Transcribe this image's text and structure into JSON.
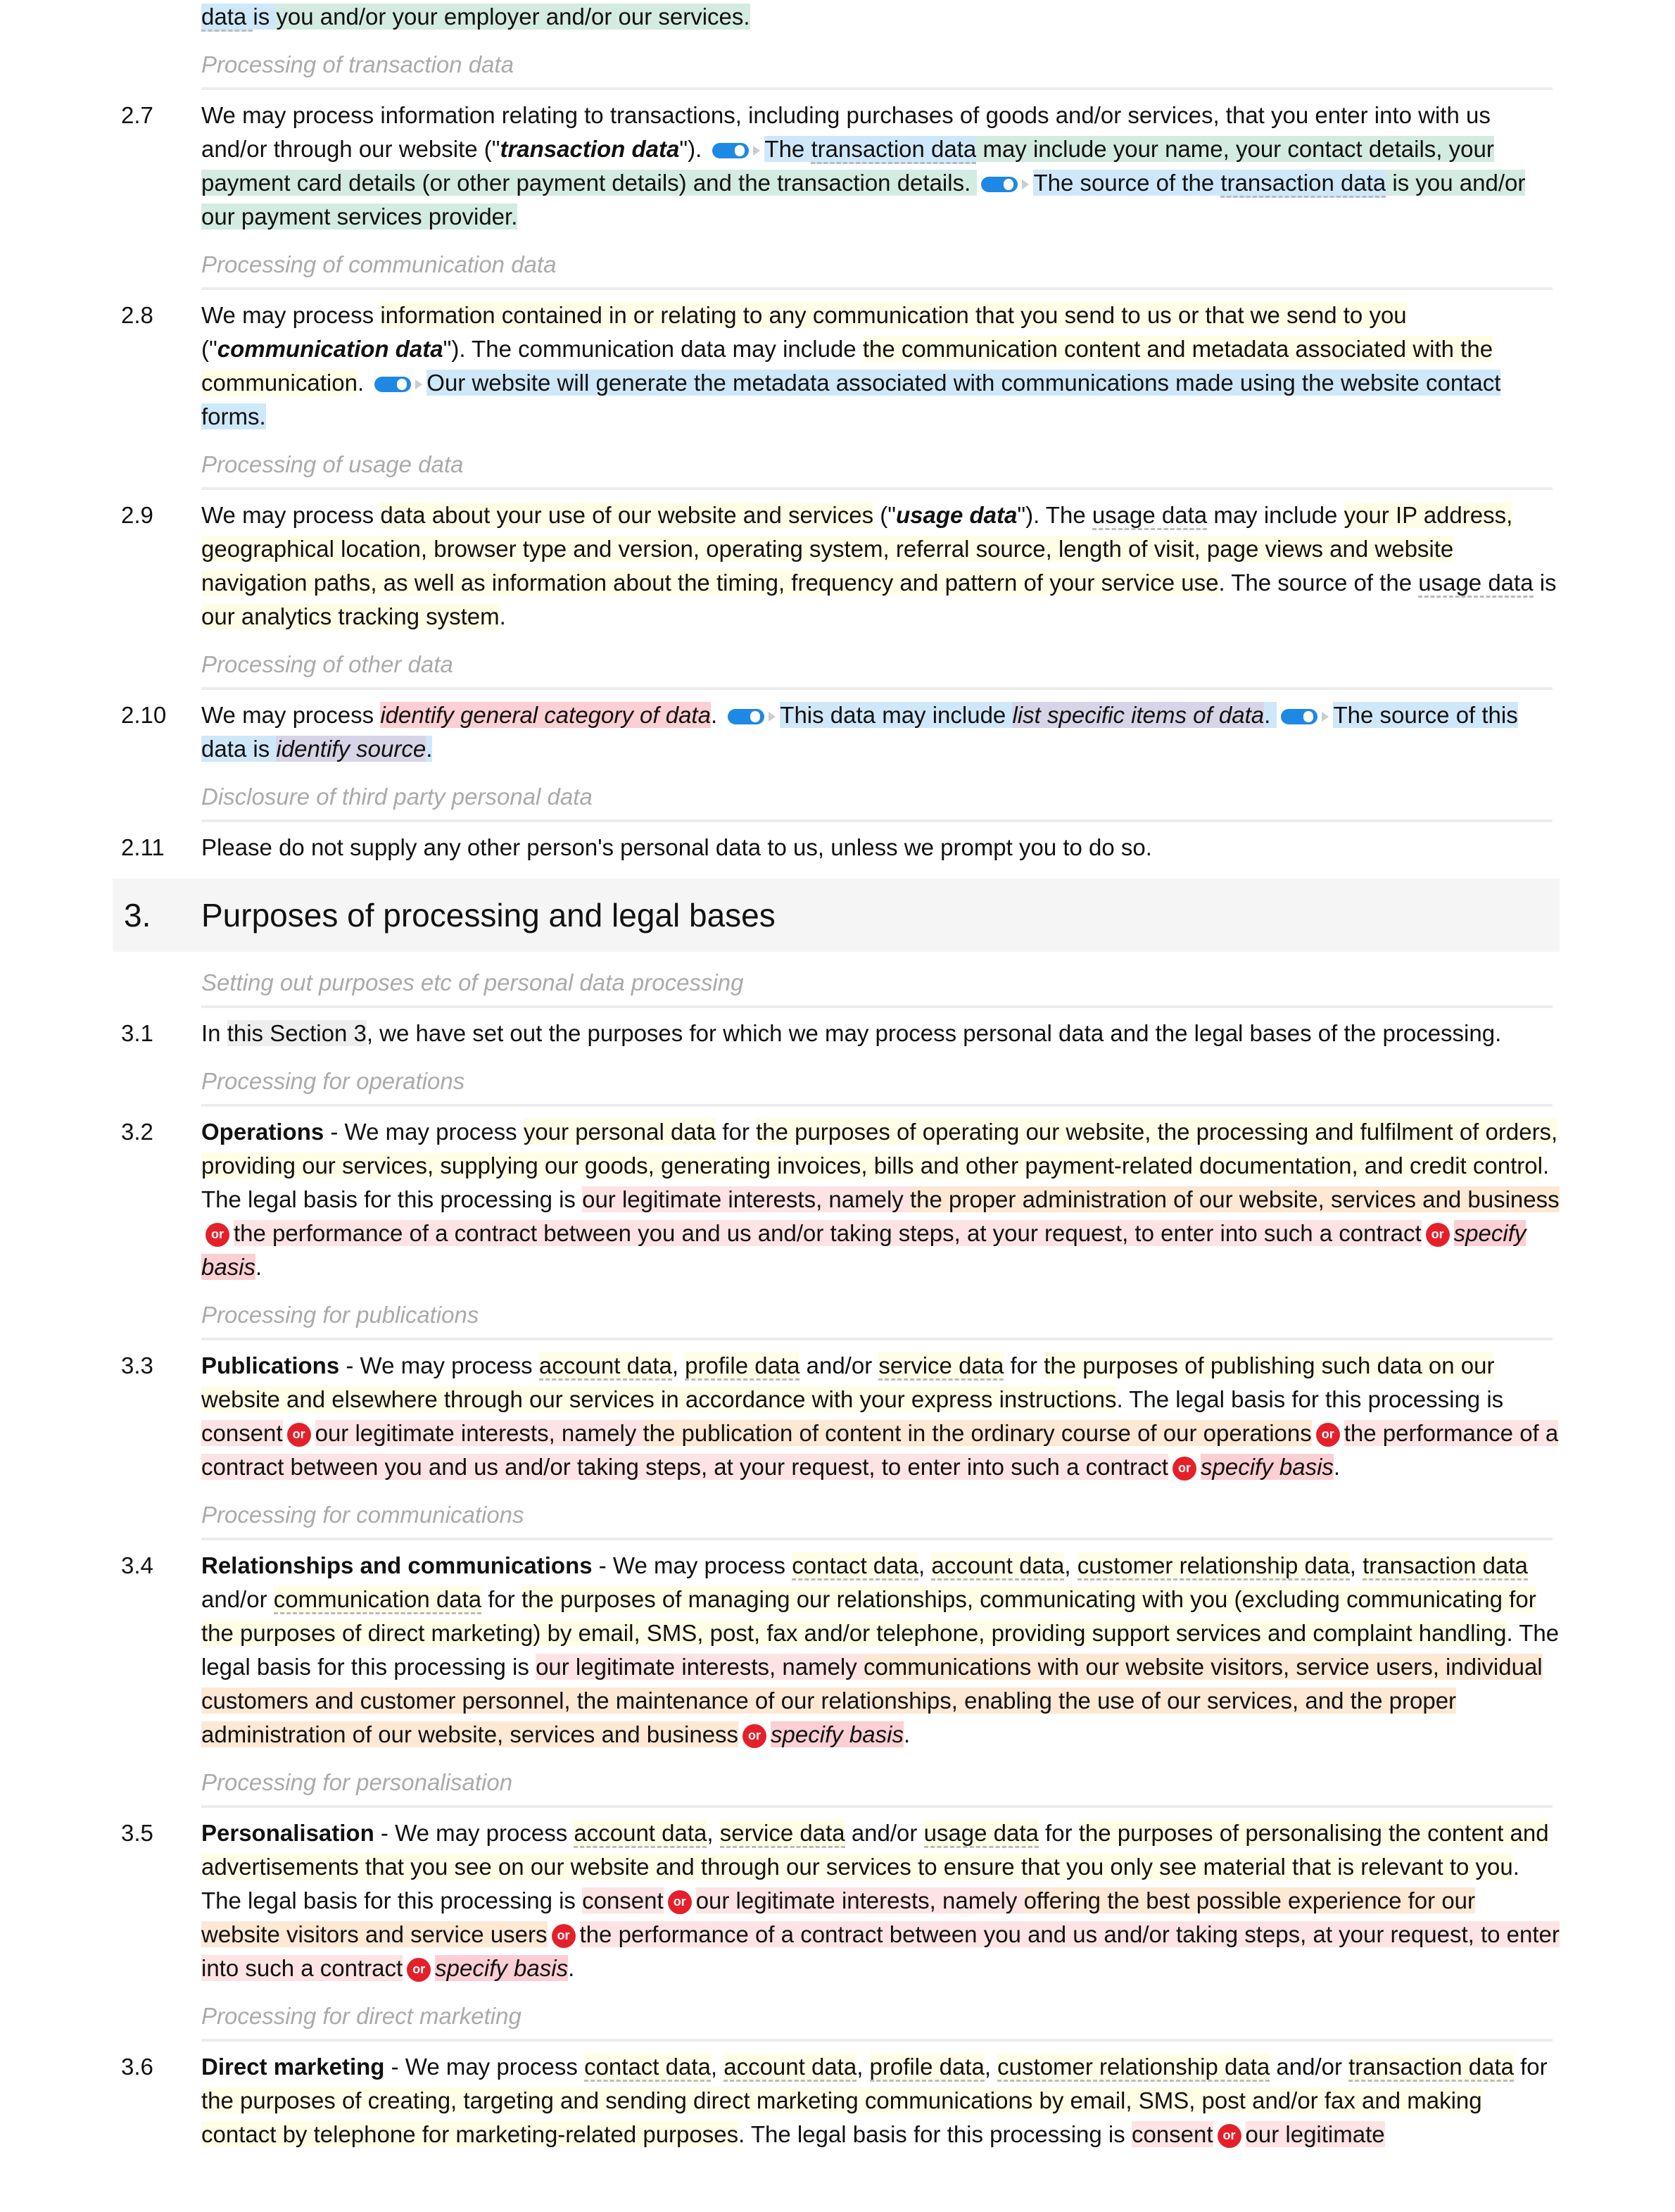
{
  "top_line": [
    [
      "data ",
      "b u"
    ],
    [
      "is ",
      "b"
    ],
    [
      "you and/or your employer and/or our services.",
      "g"
    ]
  ],
  "blocks": [
    {
      "sub": "Processing of transaction data",
      "num": "2.7",
      "segs": [
        [
          "We may process ",
          ""
        ],
        [
          "information relating to transactions, including purchases of goods and/or services, that you enter into with us and/or through our website",
          ""
        ],
        [
          " (\"",
          ""
        ],
        [
          "transaction data",
          "bi"
        ],
        [
          "\"). ",
          ""
        ],
        [
          "",
          "tog"
        ],
        [
          "The ",
          "b"
        ],
        [
          "transaction data",
          "b u"
        ],
        [
          " may include your name, your contact details, your payment card details (or other payment details) and the transaction details. ",
          "g"
        ],
        [
          "",
          "tog"
        ],
        [
          "The source of the ",
          "b"
        ],
        [
          "transaction data",
          "b u"
        ],
        [
          " is you and/or our payment services provider.",
          "g"
        ]
      ]
    },
    {
      "sub": "Processing of communication data",
      "num": "2.8",
      "segs": [
        [
          "We may process ",
          ""
        ],
        [
          "information contained in or relating to any communication that you send to us or that we send to you",
          "y"
        ],
        [
          " (\"",
          ""
        ],
        [
          "communication data",
          "bi"
        ],
        [
          "\"). The communication data may include ",
          ""
        ],
        [
          "the communication content and metadata associated with the communication",
          "y"
        ],
        [
          ". ",
          ""
        ],
        [
          "",
          "tog"
        ],
        [
          "Our website will generate the metadata associated with communications made using the website contact forms.",
          "b"
        ]
      ]
    },
    {
      "sub": "Processing of usage data",
      "num": "2.9",
      "segs": [
        [
          "We may process ",
          ""
        ],
        [
          "data about your use of our website and services",
          "y"
        ],
        [
          " (\"",
          ""
        ],
        [
          "usage data",
          "bi"
        ],
        [
          "\"). The ",
          ""
        ],
        [
          "usage data",
          "u"
        ],
        [
          " may include ",
          ""
        ],
        [
          "your IP address, geographical location, browser type and version, operating system, referral source, length of visit, page views and website navigation paths, as well as information about the timing, frequency and pattern of your service use",
          "y"
        ],
        [
          ". The source of the ",
          ""
        ],
        [
          "usage data",
          "u"
        ],
        [
          " is ",
          ""
        ],
        [
          "our analytics tracking system",
          "y"
        ],
        [
          ".",
          ""
        ]
      ]
    },
    {
      "sub": "Processing of other data",
      "num": "2.10",
      "segs": [
        [
          "We may process ",
          ""
        ],
        [
          "identify general category of data",
          "r"
        ],
        [
          ". ",
          ""
        ],
        [
          "",
          "tog"
        ],
        [
          "This data may include ",
          "b"
        ],
        [
          "list specific items of data",
          "lv"
        ],
        [
          ". ",
          "b"
        ],
        [
          "",
          "tog"
        ],
        [
          "The source of this data is ",
          "b"
        ],
        [
          "identify source",
          "lv"
        ],
        [
          ".",
          "b"
        ]
      ]
    },
    {
      "sub": "Disclosure of third party personal data",
      "num": "2.11",
      "segs": [
        [
          "Please do not supply any other person's personal data to us, unless we prompt you to do so.",
          ""
        ]
      ]
    }
  ],
  "section3": {
    "num": "3.",
    "title": "Purposes of processing and legal bases"
  },
  "blocks3": [
    {
      "sub": "Setting out purposes etc of personal data processing",
      "num": "3.1",
      "segs": [
        [
          "In ",
          ""
        ],
        [
          "this Section 3",
          "gr"
        ],
        [
          ", we have set out the purposes for which we may process personal data and the legal bases of the processing.",
          ""
        ]
      ]
    },
    {
      "sub": "Processing for operations",
      "num": "3.2",
      "segs": [
        [
          "Operations",
          "bo"
        ],
        [
          " - We may process ",
          ""
        ],
        [
          "your personal data",
          "y"
        ],
        [
          " for ",
          ""
        ],
        [
          "the purposes of operating our website, the processing and fulfilment of orders, providing our services, supplying our goods, generating invoices, bills and other payment-related documentation, and credit control",
          "y"
        ],
        [
          ". The legal basis for this processing is ",
          ""
        ],
        [
          "our legitimate interests, namely ",
          "p"
        ],
        [
          "the proper administration of our website, services and business",
          "o"
        ],
        [
          "or",
          "or"
        ],
        [
          "the performance of a contract between you and us and/or taking steps, at your request, to enter into such a contract",
          "p"
        ],
        [
          "or",
          "or"
        ],
        [
          "specify basis",
          "r"
        ],
        [
          ".",
          ""
        ]
      ]
    },
    {
      "sub": "Processing for publications",
      "num": "3.3",
      "segs": [
        [
          "Publications",
          "bo"
        ],
        [
          " - We may process ",
          ""
        ],
        [
          "account data",
          "y u"
        ],
        [
          ", ",
          ""
        ],
        [
          "profile data",
          "y u"
        ],
        [
          " and/or ",
          ""
        ],
        [
          "service data",
          "y u"
        ],
        [
          " for ",
          ""
        ],
        [
          "the purposes of publishing such data on our website and elsewhere through our services in accordance with your express instructions",
          "y"
        ],
        [
          ". The legal basis for this processing is ",
          ""
        ],
        [
          "consent",
          "p"
        ],
        [
          "or",
          "or"
        ],
        [
          "our legitimate interests, namely ",
          "p"
        ],
        [
          "the publication of content in the ordinary course of our operations",
          "o"
        ],
        [
          "or",
          "or"
        ],
        [
          "the performance of a contract between you and us and/or taking steps, at your request, to enter into such a contract",
          "p"
        ],
        [
          "or",
          "or"
        ],
        [
          "specify basis",
          "r"
        ],
        [
          ".",
          ""
        ]
      ]
    },
    {
      "sub": "Processing for communications",
      "num": "3.4",
      "segs": [
        [
          "Relationships and communications",
          "bo"
        ],
        [
          " - We may process ",
          ""
        ],
        [
          "contact data",
          "y u"
        ],
        [
          ", ",
          ""
        ],
        [
          "account data",
          "y u"
        ],
        [
          ", ",
          ""
        ],
        [
          "customer relationship data",
          "y u"
        ],
        [
          ", ",
          ""
        ],
        [
          "transaction data",
          "y u"
        ],
        [
          " and/or ",
          ""
        ],
        [
          "communication data",
          "y u"
        ],
        [
          " for ",
          ""
        ],
        [
          "the purposes of managing our relationships, communicating with you (excluding communicating for the purposes of direct marketing) by email, SMS, post, fax and/or telephone, providing support services and complaint handling",
          "y"
        ],
        [
          ". The legal basis for this processing is ",
          ""
        ],
        [
          "our legitimate interests, namely ",
          "p"
        ],
        [
          "communications with our website visitors, service users, individual customers and customer personnel, the maintenance of our relationships, enabling the use of our services, and the proper administration of our website, services and business",
          "o"
        ],
        [
          "or",
          "or"
        ],
        [
          "specify basis",
          "r"
        ],
        [
          ".",
          ""
        ]
      ]
    },
    {
      "sub": "Processing for personalisation",
      "num": "3.5",
      "segs": [
        [
          "Personalisation",
          "bo"
        ],
        [
          " - We may process ",
          ""
        ],
        [
          "account data",
          "y u"
        ],
        [
          ", ",
          ""
        ],
        [
          "service data",
          "y u"
        ],
        [
          " and/or ",
          ""
        ],
        [
          "usage data",
          "y u"
        ],
        [
          " for ",
          ""
        ],
        [
          "the purposes of personalising the content and advertisements that you see on our website and through our services to ensure that you only see material that is relevant to you",
          "y"
        ],
        [
          ". The legal basis for this processing is ",
          ""
        ],
        [
          "consent",
          "p"
        ],
        [
          "or",
          "or"
        ],
        [
          "our legitimate interests, namely ",
          "p"
        ],
        [
          "offering the best possible experience for our website visitors and service users",
          "o"
        ],
        [
          "or",
          "or"
        ],
        [
          "the performance of a contract between you and us and/or taking steps, at your request, to enter into such a contract",
          "p"
        ],
        [
          "or",
          "or"
        ],
        [
          "specify basis",
          "r"
        ],
        [
          ".",
          ""
        ]
      ]
    },
    {
      "sub": "Processing for direct marketing",
      "num": "3.6",
      "segs": [
        [
          "Direct marketing",
          "bo"
        ],
        [
          " - We may process ",
          ""
        ],
        [
          "contact data",
          "y u"
        ],
        [
          ", ",
          ""
        ],
        [
          "account data",
          "y u"
        ],
        [
          ", ",
          ""
        ],
        [
          "profile data",
          "y u"
        ],
        [
          ", ",
          ""
        ],
        [
          "customer relationship data",
          "y u"
        ],
        [
          " and/or ",
          ""
        ],
        [
          "transaction data",
          "y u"
        ],
        [
          " for ",
          ""
        ],
        [
          "the purposes of creating, targeting and sending direct marketing communications by email, SMS, post and/or fax and making contact by telephone for marketing-related purposes",
          "y"
        ],
        [
          ". The legal basis for this processing is ",
          ""
        ],
        [
          "consent",
          "p"
        ],
        [
          "or",
          "or"
        ],
        [
          "our legitimate",
          "p"
        ]
      ]
    }
  ],
  "colors": {
    "yellow": "#fefee6",
    "green": "#d4ebe1",
    "blue": "#cfe8f9",
    "pink": "#fde3e3",
    "orange": "#fde8d4",
    "red_placeholder": "#fbcfd3",
    "or_badge": "#e5202a",
    "toggle": "#1e88e5"
  }
}
